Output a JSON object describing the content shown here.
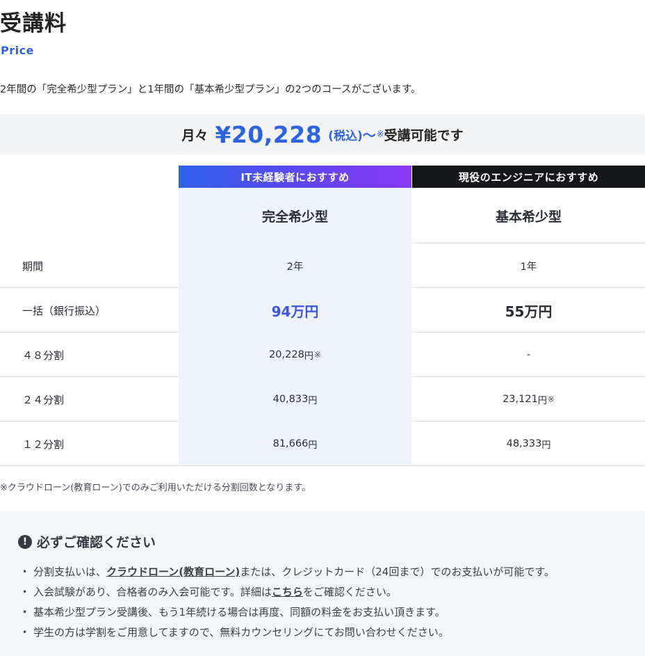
{
  "header": {
    "title": "受講料",
    "subtitle": "Price",
    "intro": "2年間の「完全希少型プラン」と1年間の「基本希少型プラン」の2つのコースがございます。"
  },
  "price_banner": {
    "prefix": "月々",
    "amount": "¥20,228",
    "tax": "(税込)",
    "tilde": "〜",
    "mark": "※",
    "suffix": "受講可能です",
    "accent_color": "#2d63e3"
  },
  "plans": [
    {
      "badge": "IT未経験者におすすめ",
      "name": "完全希少型"
    },
    {
      "badge": "現役のエンジニアにおすすめ",
      "name": "基本希少型"
    }
  ],
  "rows": [
    {
      "label": "期間",
      "plan_a": "2年",
      "plan_b": "1年"
    },
    {
      "label": "一括（銀行振込）",
      "plan_a": "94万円",
      "plan_b": "55万円"
    },
    {
      "label": "４８分割",
      "plan_a": "20,228",
      "plan_a_unit": "円",
      "plan_a_note": "※",
      "plan_b": "-"
    },
    {
      "label": "２４分割",
      "plan_a": "40,833",
      "plan_a_unit": "円",
      "plan_b": "23,121",
      "plan_b_unit": "円",
      "plan_b_note": "※"
    },
    {
      "label": "１２分割",
      "plan_a": "81,666",
      "plan_a_unit": "円",
      "plan_b": "48,333",
      "plan_b_unit": "円"
    }
  ],
  "footnote": "※クラウドローン(教育ローン)でのみご利用いただける分割回数となります。",
  "notice": {
    "icon": "exclamation-icon",
    "title": "必ずご確認ください",
    "items": [
      {
        "before": "分割支払いは、",
        "link": "クラウドローン(教育ローン)",
        "after": "または、クレジットカード（24回まで）でのお支払いが可能です。"
      },
      {
        "before": "入会試験があり、合格者のみ入会可能です。詳細は",
        "link": "こちら",
        "after": "をご確認ください。"
      },
      {
        "text": "基本希少型プラン受講後、もう1年続ける場合は再度、同額の料金をお支払い頂きます。"
      },
      {
        "text": "学生の方は学割をご用意してますので、無料カウンセリングにてお問い合わせください。"
      }
    ]
  }
}
